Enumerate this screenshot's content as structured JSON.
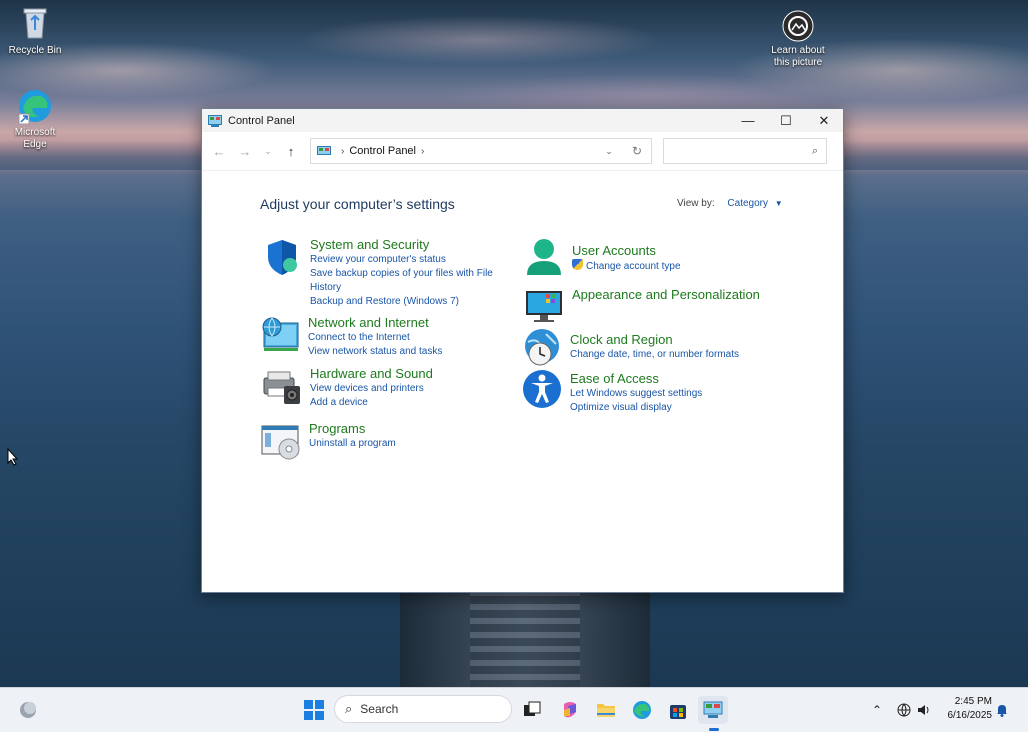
{
  "desktop": {
    "recycle_bin": "Recycle Bin",
    "edge_line1": "Microsoft",
    "edge_line2": "Edge",
    "learn_line1": "Learn about",
    "learn_line2": "this picture"
  },
  "window": {
    "title": "Control Panel",
    "minimize": "—",
    "maximize": "☐",
    "close": "✕"
  },
  "address": {
    "crumb": "Control Panel",
    "sep1": "›",
    "sep2": "›",
    "search_placeholder": ""
  },
  "content": {
    "heading": "Adjust your computer’s settings",
    "view_by_label": "View by:",
    "view_by_value": "Category"
  },
  "categories": {
    "system": {
      "title": "System and Security",
      "links": [
        "Review your computer's status",
        "Save backup copies of your files with File",
        "History",
        "Backup and Restore (Windows 7)"
      ]
    },
    "network": {
      "title": "Network and Internet",
      "links": [
        "Connect to the Internet",
        "View network status and tasks"
      ]
    },
    "hardware": {
      "title": "Hardware and Sound",
      "links": [
        "View devices and printers",
        "Add a device"
      ]
    },
    "programs": {
      "title": "Programs",
      "links": [
        "Uninstall a program"
      ]
    },
    "users": {
      "title": "User Accounts",
      "links": [
        "Change account type"
      ]
    },
    "appearance": {
      "title": "Appearance and Personalization",
      "links": []
    },
    "clock": {
      "title": "Clock and Region",
      "links": [
        "Change date, time, or number formats"
      ]
    },
    "ease": {
      "title": "Ease of Access",
      "links": [
        "Let Windows suggest settings",
        "Optimize visual display"
      ]
    }
  },
  "taskbar": {
    "search_label": "Search",
    "time": "2:45 PM",
    "date": "6/16/2025"
  },
  "colors": {
    "category_title": "#1e7a1e",
    "link": "#1a56a8",
    "heading": "#1e3a5f"
  }
}
